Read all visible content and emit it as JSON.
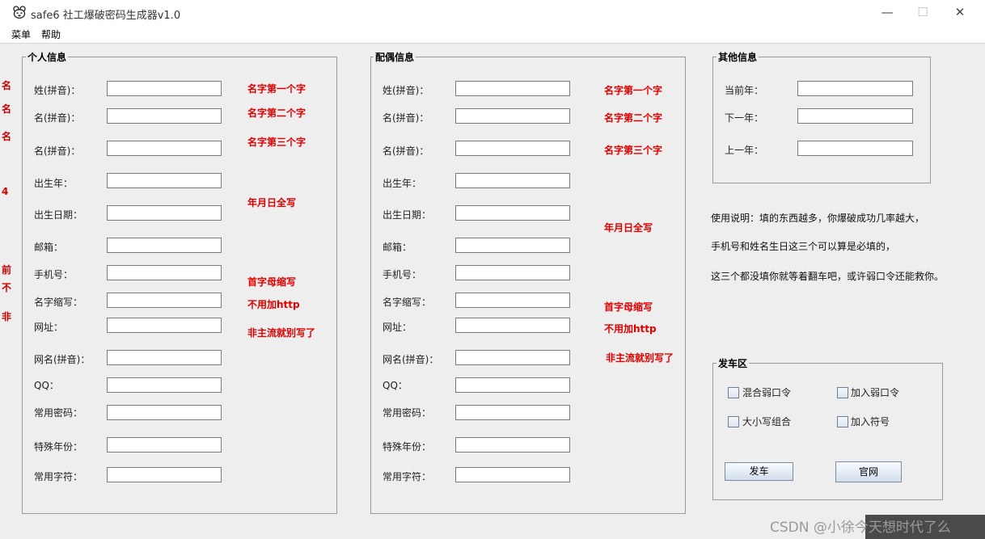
{
  "window": {
    "title": "safe6 社工爆破密码生成器v1.0",
    "minimize": "—",
    "maximize": "☐",
    "close": "✕"
  },
  "menu": {
    "items": [
      "菜单",
      "帮助"
    ]
  },
  "personal": {
    "legend": "个人信息",
    "labels": [
      "姓(拼音)：",
      "名(拼音)：",
      "名(拼音)：",
      "出生年：",
      "出生日期：",
      "邮箱：",
      "手机号：",
      "名字缩写：",
      "网址：",
      "网名(拼音)：",
      "QQ：",
      "常用密码：",
      "特殊年份：",
      "常用字符："
    ],
    "hints": [
      "名字第一个字",
      "名字第二个字",
      "名字第三个字",
      "年月日全写",
      "首字母缩写",
      "不用加http",
      "非主流就别写了"
    ]
  },
  "spouse": {
    "legend": "配偶信息",
    "labels": [
      "姓(拼音)：",
      "名(拼音)：",
      "名(拼音)：",
      "出生年：",
      "出生日期：",
      "邮箱：",
      "手机号：",
      "名字缩写：",
      "网址：",
      "网名(拼音)：",
      "QQ：",
      "常用密码：",
      "特殊年份：",
      "常用字符："
    ],
    "hints": [
      "名字第一个字",
      "名字第二个字",
      "名字第三个字",
      "年月日全写",
      "首字母缩写",
      "不用加http",
      "非主流就别写了"
    ]
  },
  "other": {
    "legend": "其他信息",
    "labels": [
      "当前年：",
      "下一年：",
      "上一年："
    ]
  },
  "instructions": [
    "使用说明：填的东西越多，你爆破成功几率越大，",
    "手机号和姓名生日这三个可以算是必填的，",
    "这三个都没填你就等着翻车吧，或许弱口令还能救你。"
  ],
  "launch": {
    "legend": "发车区",
    "checkboxes": [
      "混合弱口令",
      "加入弱口令",
      "大小写组合",
      "加入符号"
    ],
    "buttons": [
      "发车",
      "官网"
    ]
  },
  "watermark": "CSDN @小徐今天想时代了么",
  "edge_marks": [
    "名",
    "名",
    "名",
    "4",
    "前",
    "不",
    "非"
  ]
}
